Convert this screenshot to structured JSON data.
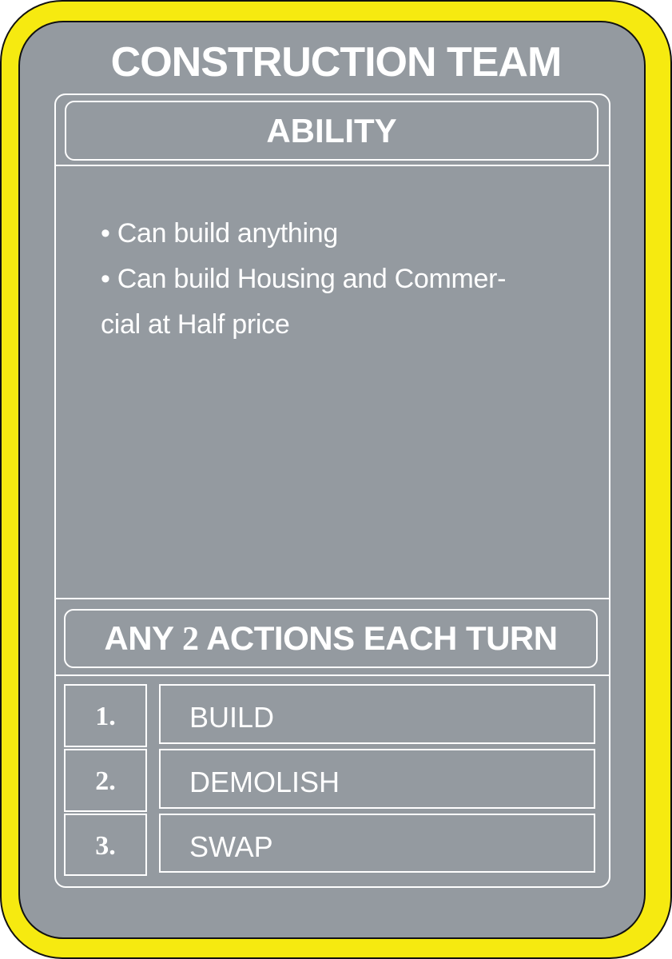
{
  "card": {
    "title": "CONSTRUCTION TEAM",
    "ability_header": "ABILITY",
    "ability_lines": [
      "• Can build anything",
      "• Can build Housing and Commer-",
      "cial at Half price"
    ],
    "actions_header": {
      "prefix": "ANY ",
      "count": "2",
      "suffix": " ACTIONS EACH TURN"
    },
    "actions": [
      {
        "number": "1.",
        "label": "BUILD"
      },
      {
        "number": "2.",
        "label": "DEMOLISH"
      },
      {
        "number": "3.",
        "label": "SWAP"
      }
    ]
  },
  "colors": {
    "border": "#f6ea10",
    "card_body": "#949aa0",
    "text": "#ffffff"
  }
}
